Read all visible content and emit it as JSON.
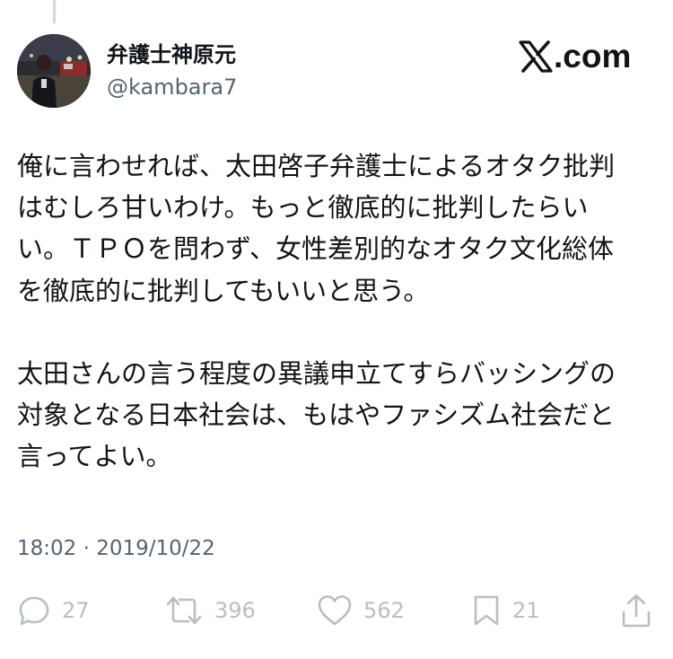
{
  "user": {
    "display_name": "弁護士神原元",
    "handle": "@kambara7"
  },
  "brand": {
    "x_letter": "X",
    "rest": ".com"
  },
  "tweet": {
    "lines": [
      "俺に言わせれば、太田啓子弁護士によるオタク批判",
      "はむしろ甘いわけ。もっと徹底的に批判したらい",
      "い。ＴＰＯを問わず、女性差別的なオタク文化総体",
      "を徹底的に批判してもいいと思う。",
      "",
      "太田さんの言う程度の異議申立てすらバッシングの",
      "対象となる日本社会は、もはやファシズム社会だと",
      "言ってよい。"
    ],
    "timestamp": "18:02 · 2019/10/22"
  },
  "actions": {
    "reply_count": "27",
    "retweet_count": "396",
    "like_count": "562",
    "bookmark_count": "21"
  },
  "icons": {
    "reply": "reply-icon",
    "retweet": "retweet-icon",
    "like": "heart-icon",
    "bookmark": "bookmark-icon",
    "share": "share-icon"
  },
  "colors": {
    "text": "#0f1419",
    "secondary": "#536471",
    "action_icon": "#b5bfc7",
    "thread_line": "#cfd9de"
  }
}
